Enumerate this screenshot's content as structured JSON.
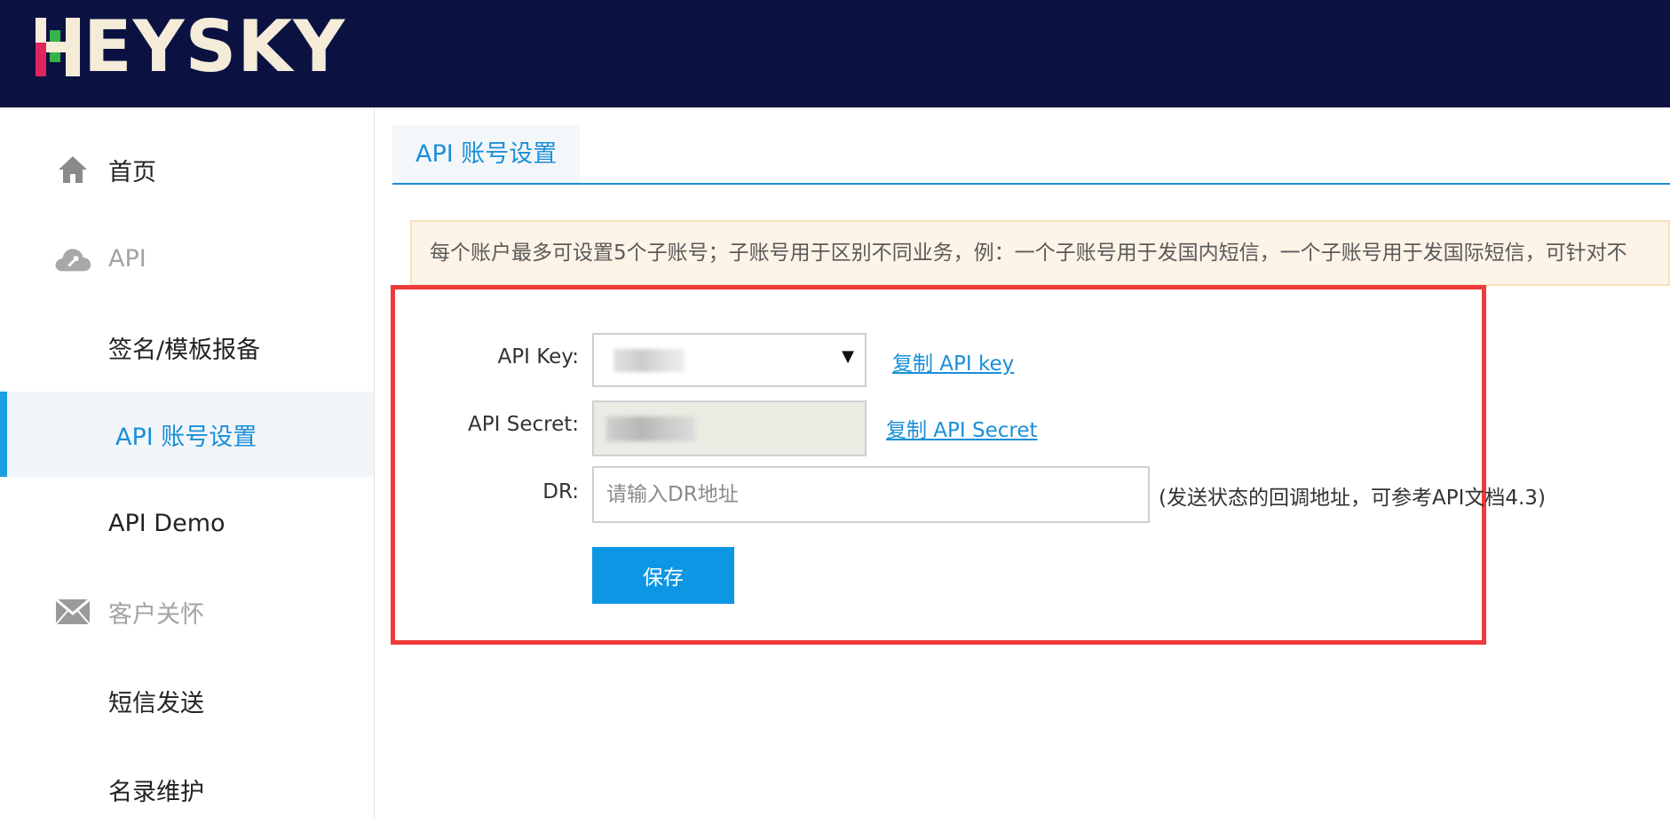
{
  "header": {
    "logo_text": "EYSKY",
    "logo_full": "HEYSKY",
    "colors": {
      "background": "#0b1242",
      "logo": "#f4ecd9",
      "accent_red": "#e0245e",
      "accent_green": "#35b24a"
    }
  },
  "sidebar": {
    "items": [
      {
        "label": "首页",
        "icon": "home-icon",
        "type": "link"
      },
      {
        "label": "API",
        "icon": "cloud-icon",
        "type": "group"
      },
      {
        "label": "签名/模板报备",
        "type": "link"
      },
      {
        "label": "API 账号设置",
        "type": "link",
        "active": true
      },
      {
        "label": "API Demo",
        "type": "link"
      },
      {
        "label": "客户关怀",
        "icon": "mail-icon",
        "type": "group"
      },
      {
        "label": "短信发送",
        "type": "link"
      },
      {
        "label": "名录维护",
        "type": "link"
      }
    ],
    "active_color": "#1a9fe0"
  },
  "main": {
    "tab_label": "API 账号设置",
    "notice": "每个账户最多可设置5个子账号；子账号用于区别不同业务，例：一个子账号用于发国内短信，一个子账号用于发国际短信，可针对不",
    "form": {
      "api_key_label": "API Key:",
      "api_key_value_redacted": true,
      "copy_api_key": "复制 API key",
      "api_secret_label": "API Secret:",
      "api_secret_value_redacted": true,
      "copy_api_secret": "复制 API Secret",
      "dr_label": "DR:",
      "dr_placeholder": "请输入DR地址",
      "dr_value": "",
      "dr_hint": "(发送状态的回调地址，可参考API文档4.3)",
      "save_label": "保存"
    },
    "highlight_color": "#ef3b3b",
    "primary_color": "#0d96e3"
  }
}
